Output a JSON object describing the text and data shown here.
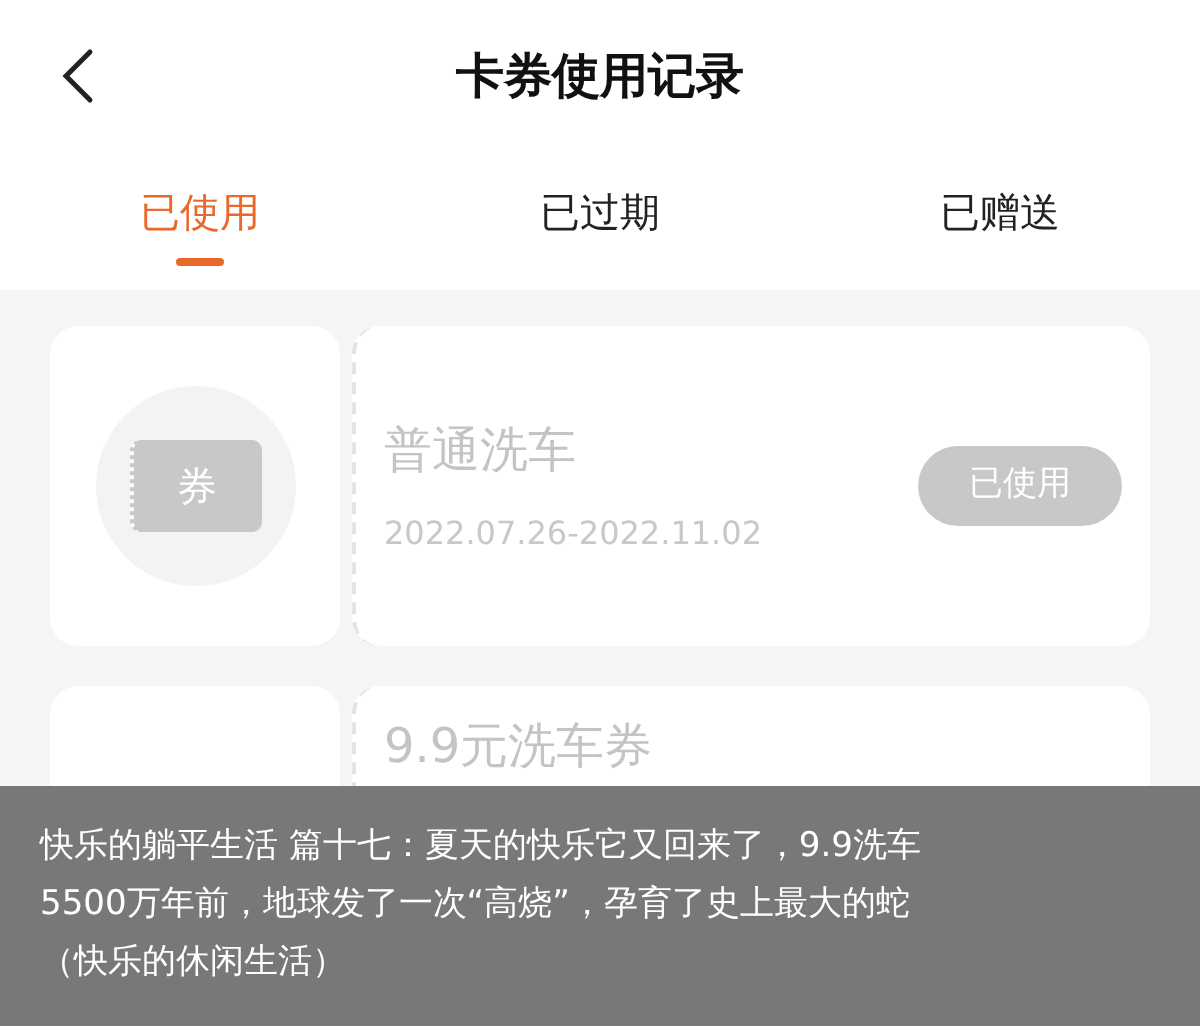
{
  "header": {
    "title": "卡券使用记录"
  },
  "tabs": [
    {
      "label": "已使用",
      "selected": true
    },
    {
      "label": "已过期",
      "selected": false
    },
    {
      "label": "已赠送",
      "selected": false
    }
  ],
  "coupons": [
    {
      "stub": "券",
      "title": "普通洗车",
      "dates": "2022.07.26-2022.11.02",
      "status": "已使用"
    },
    {
      "title": "9.9元洗车券"
    }
  ],
  "caption": {
    "lines": [
      "快乐的躺平生活 篇十七：夏天的快乐它又回来了，9.9洗车",
      "5500万年前，地球发了一次“高烧”，孕育了史上最大的蛇",
      "（快乐的休闲生活）"
    ]
  }
}
